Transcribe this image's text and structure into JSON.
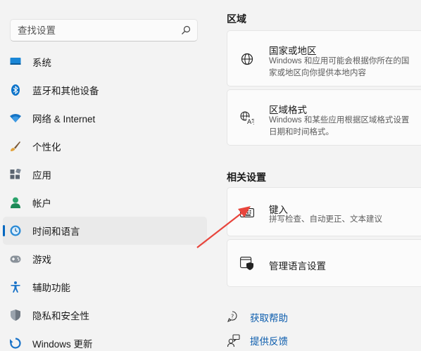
{
  "search": {
    "placeholder": "查找设置"
  },
  "nav": [
    {
      "label": "系统",
      "icon": "display-icon"
    },
    {
      "label": "蓝牙和其他设备",
      "icon": "bluetooth-icon"
    },
    {
      "label": "网络 & Internet",
      "icon": "wifi-icon"
    },
    {
      "label": "个性化",
      "icon": "brush-icon"
    },
    {
      "label": "应用",
      "icon": "apps-icon"
    },
    {
      "label": "帐户",
      "icon": "person-icon"
    },
    {
      "label": "时间和语言",
      "icon": "clock-globe-icon",
      "active": true
    },
    {
      "label": "游戏",
      "icon": "gamepad-icon"
    },
    {
      "label": "辅助功能",
      "icon": "accessibility-icon"
    },
    {
      "label": "隐私和安全性",
      "icon": "shield-icon"
    },
    {
      "label": "Windows 更新",
      "icon": "update-icon"
    }
  ],
  "main": {
    "region_title": "区域",
    "country": {
      "title": "国家或地区",
      "desc": "Windows 和应用可能会根据你所在的国家或地区向你提供本地内容"
    },
    "format": {
      "title": "区域格式",
      "desc": "Windows 和某些应用根据区域格式设置日期和时间格式。"
    },
    "related_title": "相关设置",
    "typing": {
      "title": "键入",
      "desc": "拼写检查、自动更正、文本建议"
    },
    "lang_admin": {
      "title": "管理语言设置"
    },
    "help": "获取帮助",
    "feedback": "提供反馈"
  },
  "colors": {
    "accent": "#0067c0",
    "link": "#0b5cad",
    "arrow": "#e8453c"
  }
}
